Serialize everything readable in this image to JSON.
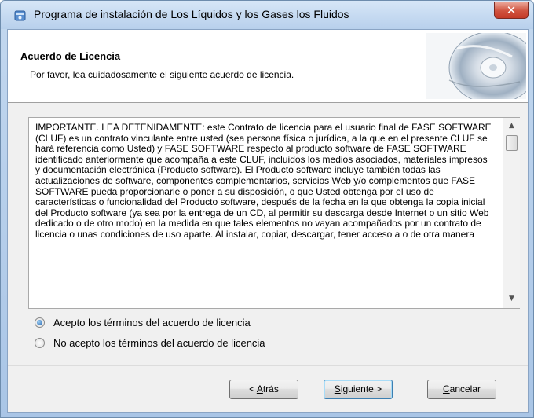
{
  "window": {
    "title": "Programa de instalación de Los Líquidos y los Gases  los Fluidos",
    "close_glyph": "✕"
  },
  "header": {
    "title": "Acuerdo de Licencia",
    "subtitle": "Por favor, lea cuidadosamente el siguiente acuerdo de licencia."
  },
  "license": {
    "text": "IMPORTANTE. LEA DETENIDAMENTE: este Contrato de licencia para el usuario final de FASE SOFTWARE (CLUF) es un contrato vinculante entre usted (sea persona física o jurídica, a la que en el presente CLUF se hará referencia como Usted) y FASE SOFTWARE respecto al producto software de FASE SOFTWARE identificado anteriormente que acompaña a este CLUF, incluidos los medios asociados, materiales impresos y documentación electrónica (Producto software).  El Producto software incluye también todas las actualizaciones de software, componentes complementarios, servicios Web y/o complementos que FASE SOFTWARE pueda proporcionarle o poner a su disposición, o que Usted obtenga por el uso de características o funcionalidad del Producto software, después de la fecha en la que obtenga la copia inicial del Producto software (ya sea por la entrega de un CD, al permitir su descarga desde Internet o un sitio Web dedicado o de otro modo) en la medida en que tales elementos no vayan acompañados por un contrato de licencia o unas condiciones de uso aparte.  Al instalar, copiar, descargar, tener acceso a o de otra manera"
  },
  "options": {
    "accept": "Acepto los términos del acuerdo de licencia",
    "decline": "No acepto los términos del acuerdo de licencia",
    "selected": "accept"
  },
  "buttons": {
    "back_prefix": "< ",
    "back_mnemonic": "A",
    "back_rest": "trás",
    "next_mnemonic": "S",
    "next_rest": "iguiente >",
    "cancel_mnemonic": "C",
    "cancel_rest": "ancelar"
  },
  "icons": {
    "app": "installer-app-icon",
    "art": "cd-disc-art",
    "scroll_up": "▲",
    "scroll_down": "▼"
  }
}
